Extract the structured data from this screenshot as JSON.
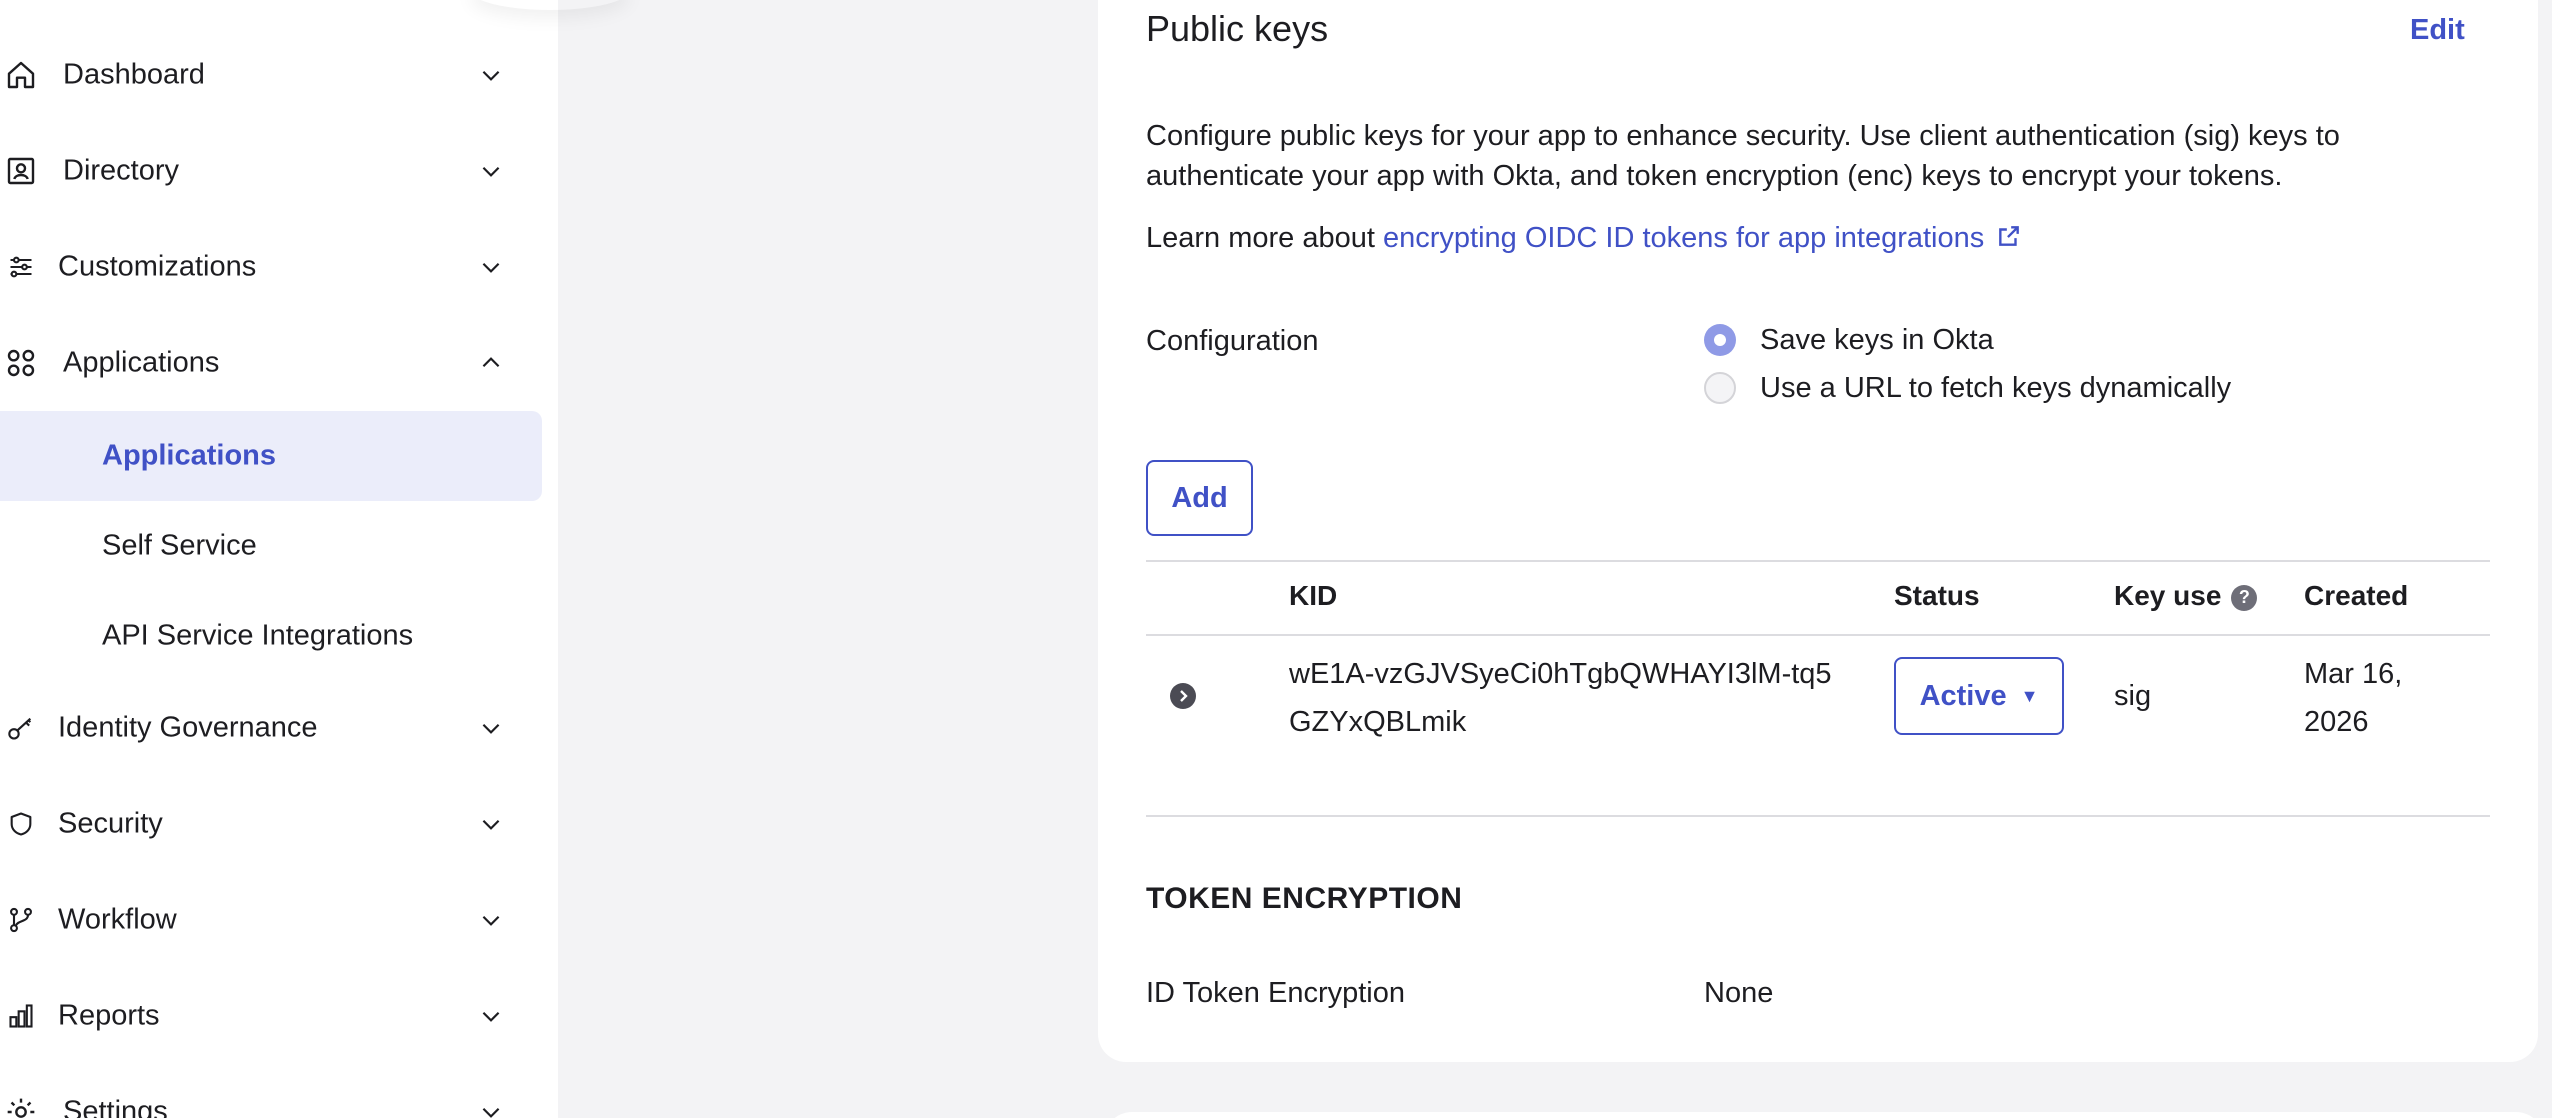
{
  "sidebar": {
    "items": [
      {
        "label": "Dashboard",
        "icon": "home-icon",
        "expanded": false
      },
      {
        "label": "Directory",
        "icon": "directory-icon",
        "expanded": false
      },
      {
        "label": "Customizations",
        "icon": "sliders-icon",
        "expanded": false
      },
      {
        "label": "Applications",
        "icon": "apps-grid-icon",
        "expanded": true
      },
      {
        "label": "Identity Governance",
        "icon": "key-icon",
        "expanded": false
      },
      {
        "label": "Security",
        "icon": "shield-icon",
        "expanded": false
      },
      {
        "label": "Workflow",
        "icon": "workflow-icon",
        "expanded": false
      },
      {
        "label": "Reports",
        "icon": "bar-chart-icon",
        "expanded": false
      },
      {
        "label": "Settings",
        "icon": "gear-icon",
        "expanded": false
      }
    ],
    "applications_sub": [
      {
        "label": "Applications",
        "active": true
      },
      {
        "label": "Self Service",
        "active": false
      },
      {
        "label": "API Service Integrations",
        "active": false
      }
    ]
  },
  "public_keys": {
    "title": "Public keys",
    "edit_label": "Edit",
    "description": "Configure public keys for your app to enhance security. Use client authentication (sig) keys to authenticate your app with Okta, and token encryption (enc) keys to encrypt your tokens.",
    "learn_prefix": "Learn more about",
    "learn_link": "encrypting OIDC ID tokens for app integrations",
    "configuration_label": "Configuration",
    "radio_options": [
      {
        "label": "Save keys in Okta",
        "checked": true
      },
      {
        "label": "Use a URL to fetch keys dynamically",
        "checked": false
      }
    ],
    "add_label": "Add",
    "table": {
      "columns": [
        "KID",
        "Status",
        "Key use",
        "Created"
      ],
      "rows": [
        {
          "kid": "wE1A-vzGJVSyeCi0hTgbQWHAYI3lM-tq5GZYxQBLmik",
          "status": "Active",
          "key_use": "sig",
          "created": "Mar 16, 2026"
        }
      ]
    }
  },
  "token_encryption": {
    "title": "TOKEN ENCRYPTION",
    "field_label": "ID Token Encryption",
    "field_value": "None"
  },
  "colors": {
    "accent": "#4051c6",
    "active_nav_bg": "#ebedfa",
    "radio_checked": "#8f9ae6"
  }
}
